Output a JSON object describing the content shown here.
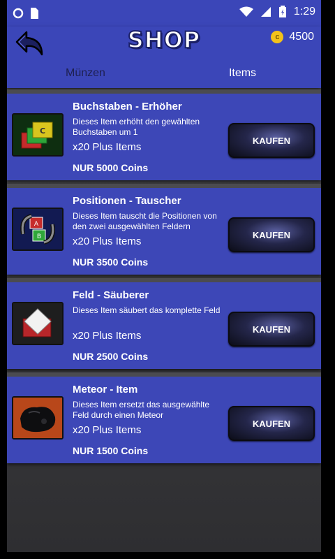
{
  "status_bar": {
    "time": "1:29",
    "icons": [
      "circle-icon",
      "sim-card-icon",
      "wifi-icon",
      "signal-icon",
      "battery-icon"
    ]
  },
  "header": {
    "back_icon": "back-arrow-icon",
    "title": "SHOP",
    "coin_balance": "4500",
    "coin_icon_glyph": "c"
  },
  "tabs": [
    {
      "label": "Münzen",
      "active": false
    },
    {
      "label": "Items",
      "active": true
    }
  ],
  "items": [
    {
      "title": "Buchstaben - Erhöher",
      "description": "Dieses Item erhöht den gewählten Buchstaben um 1",
      "quantity": "x20 Plus Items",
      "price": "NUR 5000 Coins",
      "button": "KAUFEN",
      "icon": "letter-boost-icon"
    },
    {
      "title": "Positionen - Tauscher",
      "description": "Dieses Item tauscht die Positionen von den zwei ausgewählten Feldern",
      "quantity": "x20 Plus Items",
      "price": "NUR 3500 Coins",
      "button": "KAUFEN",
      "icon": "swap-icon"
    },
    {
      "title": "Feld - Säuberer",
      "description": "Dieses Item säubert das komplette Feld",
      "quantity": "x20 Plus Items",
      "price": "NUR 2500 Coins",
      "button": "KAUFEN",
      "icon": "field-cleaner-icon"
    },
    {
      "title": "Meteor - Item",
      "description": "Dieses Item ersetzt das ausgewählte Feld durch einen Meteor",
      "quantity": "x20 Plus Items",
      "price": "NUR 1500 Coins",
      "button": "KAUFEN",
      "icon": "meteor-icon"
    }
  ],
  "colors": {
    "primary": "#3b46b8",
    "card": "#3d47b7",
    "background": "#3a3a3d",
    "coin": "#f3c21a"
  }
}
